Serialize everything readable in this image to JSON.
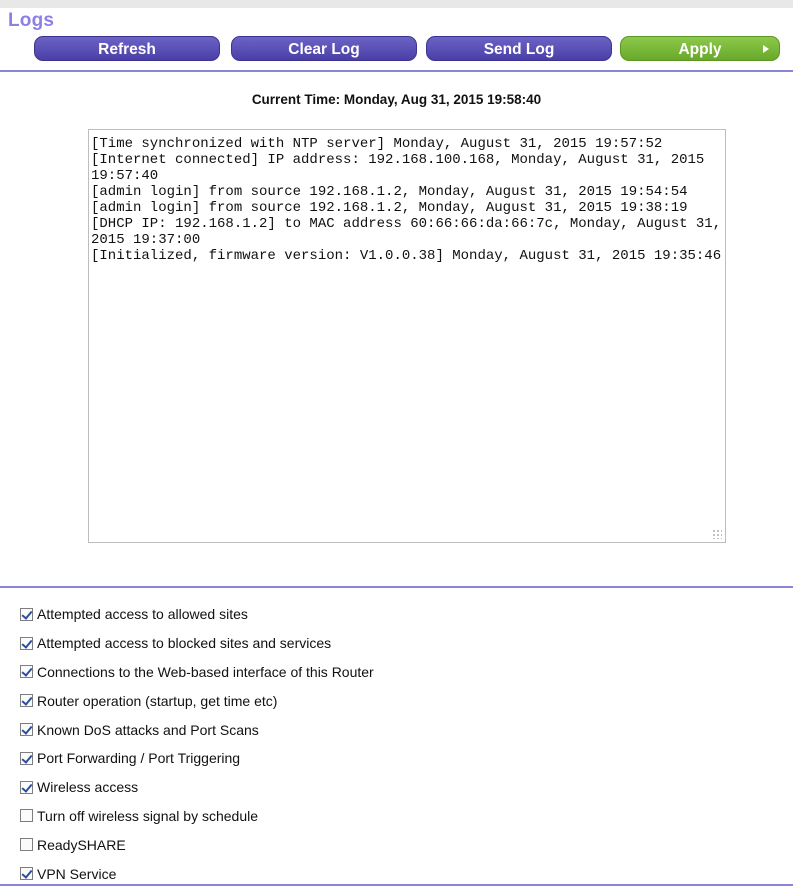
{
  "page": {
    "title": "Logs"
  },
  "toolbar": {
    "refresh_label": "Refresh",
    "clear_label": "Clear Log",
    "send_label": "Send Log",
    "apply_label": "Apply"
  },
  "current_time": "Current Time: Monday, Aug 31, 2015 19:58:40",
  "log": {
    "text": "[Time synchronized with NTP server] Monday, August 31, 2015 19:57:52\n[Internet connected] IP address: 192.168.100.168, Monday, August 31, 2015 19:57:40\n[admin login] from source 192.168.1.2, Monday, August 31, 2015 19:54:54\n[admin login] from source 192.168.1.2, Monday, August 31, 2015 19:38:19\n[DHCP IP: 192.168.1.2] to MAC address 60:66:66:da:66:7c, Monday, August 31, 2015 19:37:00\n[Initialized, firmware version: V1.0.0.38] Monday, August 31, 2015 19:35:46"
  },
  "options": [
    {
      "label": "Attempted access to allowed sites",
      "checked": true
    },
    {
      "label": "Attempted access to blocked sites and services",
      "checked": true
    },
    {
      "label": "Connections to the Web-based interface of this Router",
      "checked": true
    },
    {
      "label": "Router operation (startup, get time etc)",
      "checked": true
    },
    {
      "label": "Known DoS attacks and Port Scans",
      "checked": true
    },
    {
      "label": "Port Forwarding / Port Triggering",
      "checked": true
    },
    {
      "label": "Wireless access",
      "checked": true
    },
    {
      "label": "Turn off wireless signal by schedule",
      "checked": false
    },
    {
      "label": "ReadySHARE",
      "checked": false
    },
    {
      "label": "VPN Service",
      "checked": true
    }
  ],
  "colors": {
    "title": "#8c7fe6",
    "button": "#5a50b6",
    "apply_button": "#7ab83a",
    "divider": "#8a86d6"
  }
}
